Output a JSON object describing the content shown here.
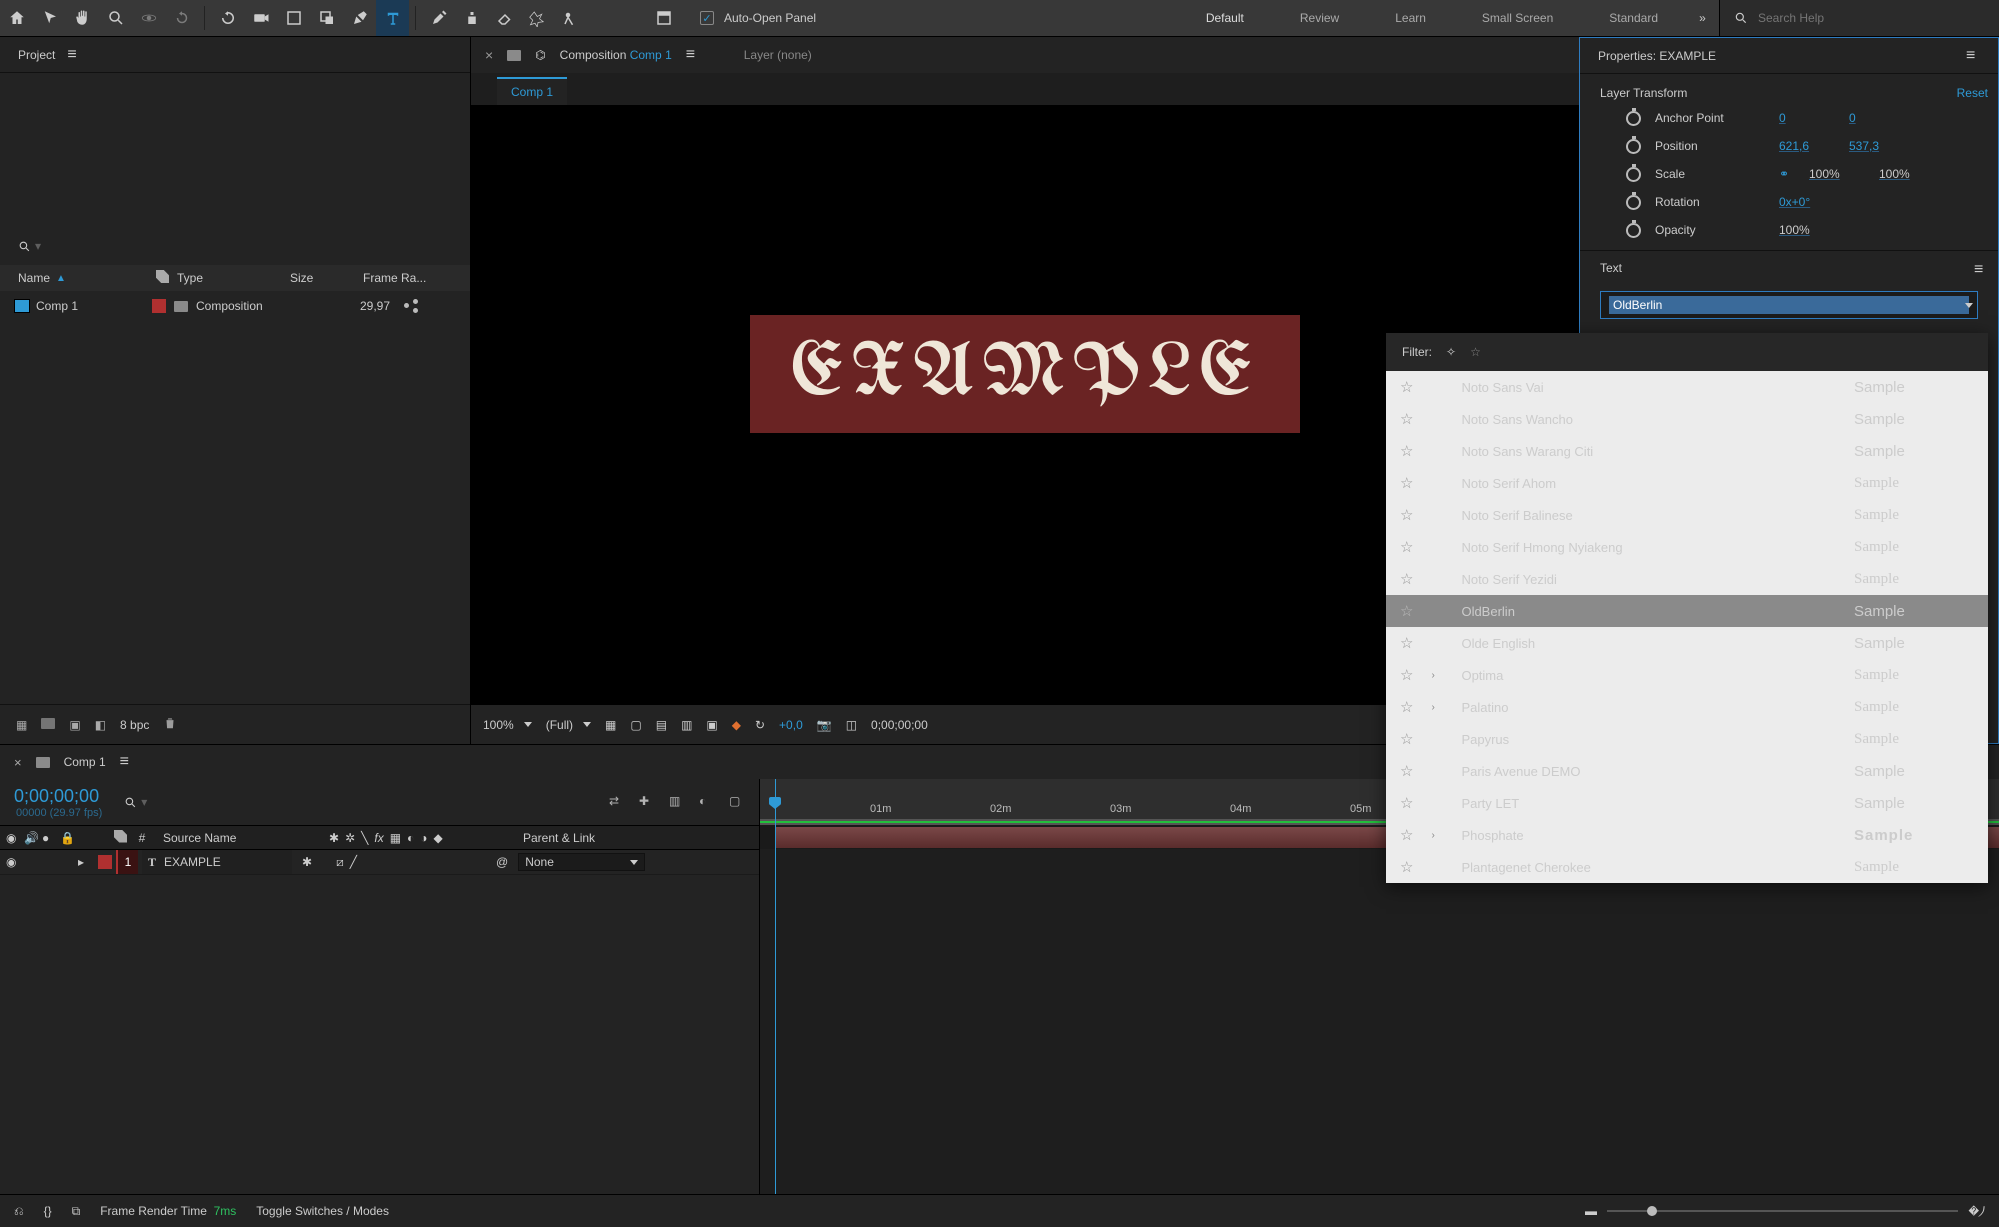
{
  "toolbar": {
    "auto_open_label": "Auto-Open Panel",
    "auto_open_checked": true
  },
  "workspaces": [
    "Default",
    "Review",
    "Learn",
    "Small Screen",
    "Standard"
  ],
  "workspace_active": "Default",
  "search": {
    "placeholder": "Search Help"
  },
  "project": {
    "tab": "Project",
    "columns": {
      "name": "Name",
      "type": "Type",
      "size": "Size",
      "fr": "Frame Ra..."
    },
    "item": {
      "name": "Comp 1",
      "type": "Composition",
      "fr": "29,97"
    },
    "bpc": "8 bpc"
  },
  "composition": {
    "tab_prefix": "Composition",
    "tab_link": "Comp 1",
    "layer_tab": "Layer (none)",
    "subtab": "Comp 1",
    "viewer_text": "EXAMPLE",
    "viewer_box_color": "#6a2323",
    "zoom": "100%",
    "res": "(Full)",
    "exposure": "+0,0",
    "timecode": "0;00;00;00"
  },
  "properties": {
    "title": "Properties: EXAMPLE",
    "transform_label": "Layer Transform",
    "reset": "Reset",
    "rows": {
      "anchor": {
        "label": "Anchor Point",
        "x": "0",
        "y": "0"
      },
      "position": {
        "label": "Position",
        "x": "621,6",
        "y": "537,3"
      },
      "scale": {
        "label": "Scale",
        "x": "100",
        "ux": "%",
        "y": "100",
        "uy": "%"
      },
      "rotation": {
        "label": "Rotation",
        "v": "0x+0°"
      },
      "opacity": {
        "label": "Opacity",
        "v": "100",
        "u": "%"
      }
    },
    "text_label": "Text",
    "font_value": "OldBerlin"
  },
  "font_dropdown": {
    "filter_label": "Filter:",
    "sample_word": "Sample",
    "items": [
      {
        "name": "Noto Sans Vai",
        "has_sub": false,
        "style": "sans"
      },
      {
        "name": "Noto Sans Wancho",
        "has_sub": false,
        "style": "sans"
      },
      {
        "name": "Noto Sans Warang Citi",
        "has_sub": false,
        "style": "sans"
      },
      {
        "name": "Noto Serif Ahom",
        "has_sub": false,
        "style": "serif"
      },
      {
        "name": "Noto Serif Balinese",
        "has_sub": false,
        "style": "serif"
      },
      {
        "name": "Noto Serif Hmong Nyiakeng",
        "has_sub": false,
        "style": "serif"
      },
      {
        "name": "Noto Serif Yezidi",
        "has_sub": false,
        "style": "serif"
      },
      {
        "name": "OldBerlin",
        "has_sub": false,
        "style": "blackletter",
        "selected": true
      },
      {
        "name": "Olde English",
        "has_sub": false,
        "style": "blackletter"
      },
      {
        "name": "Optima",
        "has_sub": true,
        "style": "serif"
      },
      {
        "name": "Palatino",
        "has_sub": true,
        "style": "serif"
      },
      {
        "name": "Papyrus",
        "has_sub": false,
        "style": "fantasy"
      },
      {
        "name": "Paris Avenue DEMO",
        "has_sub": false,
        "style": "script_b"
      },
      {
        "name": "Party LET",
        "has_sub": false,
        "style": "script"
      },
      {
        "name": "Phosphate",
        "has_sub": true,
        "style": "bold"
      },
      {
        "name": "Plantagenet Cherokee",
        "has_sub": false,
        "style": "serif"
      }
    ]
  },
  "timeline": {
    "tab": "Comp 1",
    "timecode": "0;00;00;00",
    "tc_sub": "00000 (29.97 fps)",
    "cols": {
      "idx": "#",
      "source": "Source Name",
      "parent": "Parent & Link"
    },
    "layer": {
      "idx": "1",
      "name": "EXAMPLE",
      "parent": "None"
    },
    "ruler": [
      "01m",
      "02m",
      "03m",
      "04m",
      "05m"
    ],
    "render_time_label": "Frame Render Time",
    "render_time_value": "7ms",
    "toggle": "Toggle Switches / Modes"
  }
}
